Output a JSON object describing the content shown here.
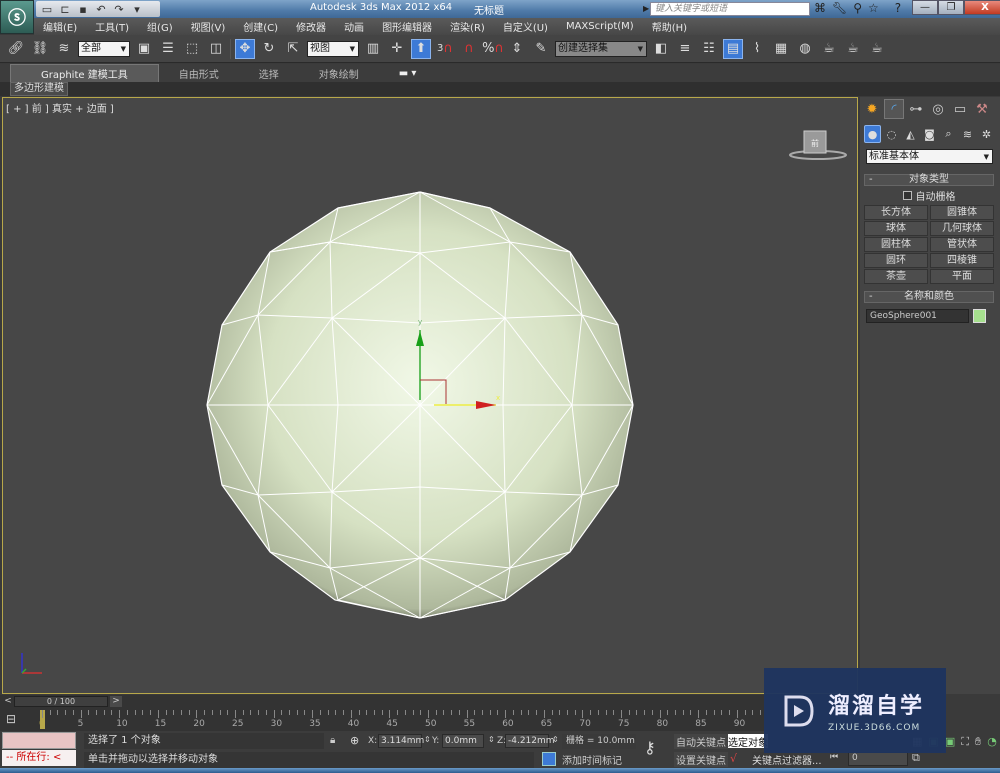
{
  "titlebar": {
    "app_title": "Autodesk 3ds Max  2012 x64",
    "document": "无标题",
    "search_placeholder": "键入关键字或短语",
    "quick_access_icons": [
      "new-file-icon",
      "open-file-icon",
      "save-icon",
      "undo-icon",
      "redo-icon",
      "dropdown-icon"
    ],
    "right_icons": [
      "binoculars-icon",
      "wrench-icon",
      "satellite-icon",
      "star-icon",
      "help-icon"
    ],
    "window_buttons": {
      "minimize": "—",
      "maximize": "❐",
      "close": "X"
    }
  },
  "menubar": {
    "items": [
      "编辑(E)",
      "工具(T)",
      "组(G)",
      "视图(V)",
      "创建(C)",
      "修改器",
      "动画",
      "图形编辑器",
      "渲染(R)",
      "自定义(U)",
      "MAXScript(M)",
      "帮助(H)"
    ]
  },
  "toolbar": {
    "selection_filter": "全部",
    "reference_coord": "视图",
    "named_selection_set": "创建选择集",
    "snap_labels": {
      "snap3": "3",
      "angle": "",
      "percent": "%"
    }
  },
  "ribbon": {
    "tabs": [
      "Graphite 建模工具",
      "自由形式",
      "选择",
      "对象绘制"
    ],
    "active_tab": "Graphite 建模工具",
    "panel_tab": "多边形建模"
  },
  "viewport": {
    "label": "[ + ] 前 ] 真实 + 边面 ]",
    "viewcube_face": "前",
    "gizmo_y_label": "y",
    "gizmo_x_label": "x",
    "object_color": "#dfe9cf"
  },
  "command_panel": {
    "category": "标准基本体",
    "object_type": {
      "title": "对象类型",
      "autogrid_label": "自动栅格",
      "autogrid_checked": false,
      "buttons": [
        "长方体",
        "圆锥体",
        "球体",
        "几何球体",
        "圆柱体",
        "管状体",
        "圆环",
        "四棱锥",
        "茶壶",
        "平面"
      ]
    },
    "name_color": {
      "title": "名称和颜色",
      "name": "GeoSphere001",
      "color": "#a6e08e"
    }
  },
  "timeline": {
    "slider_label": "0 / 100",
    "current_frame": 0,
    "total_frames": 100,
    "ticks": [
      "0",
      "5",
      "10",
      "15",
      "20",
      "25",
      "30",
      "35",
      "40",
      "45",
      "50",
      "55",
      "60",
      "65",
      "70",
      "75",
      "80",
      "85",
      "90"
    ]
  },
  "status": {
    "maxscript_line": "-- 所在行:",
    "maxscript_arrow": "<",
    "selection": "选择了 1 个对象",
    "prompt": "单击并拖动以选择并移动对象",
    "x_label": "X:",
    "x": "3.114mm",
    "y_label": "Y:",
    "y": "0.0mm",
    "z_label": "Z:",
    "z": "-4.212mm",
    "grid": "栅格 = 10.0mm",
    "add_time_tag": "添加时间标记",
    "auto_key": "自动关键点",
    "set_key": "设置关键点",
    "selected_set": "选定对象",
    "key_filters": "关键点过滤器...",
    "frame_field": "0"
  },
  "watermark": {
    "title": "溜溜自学",
    "url": "ZIXUE.3D66.COM"
  }
}
